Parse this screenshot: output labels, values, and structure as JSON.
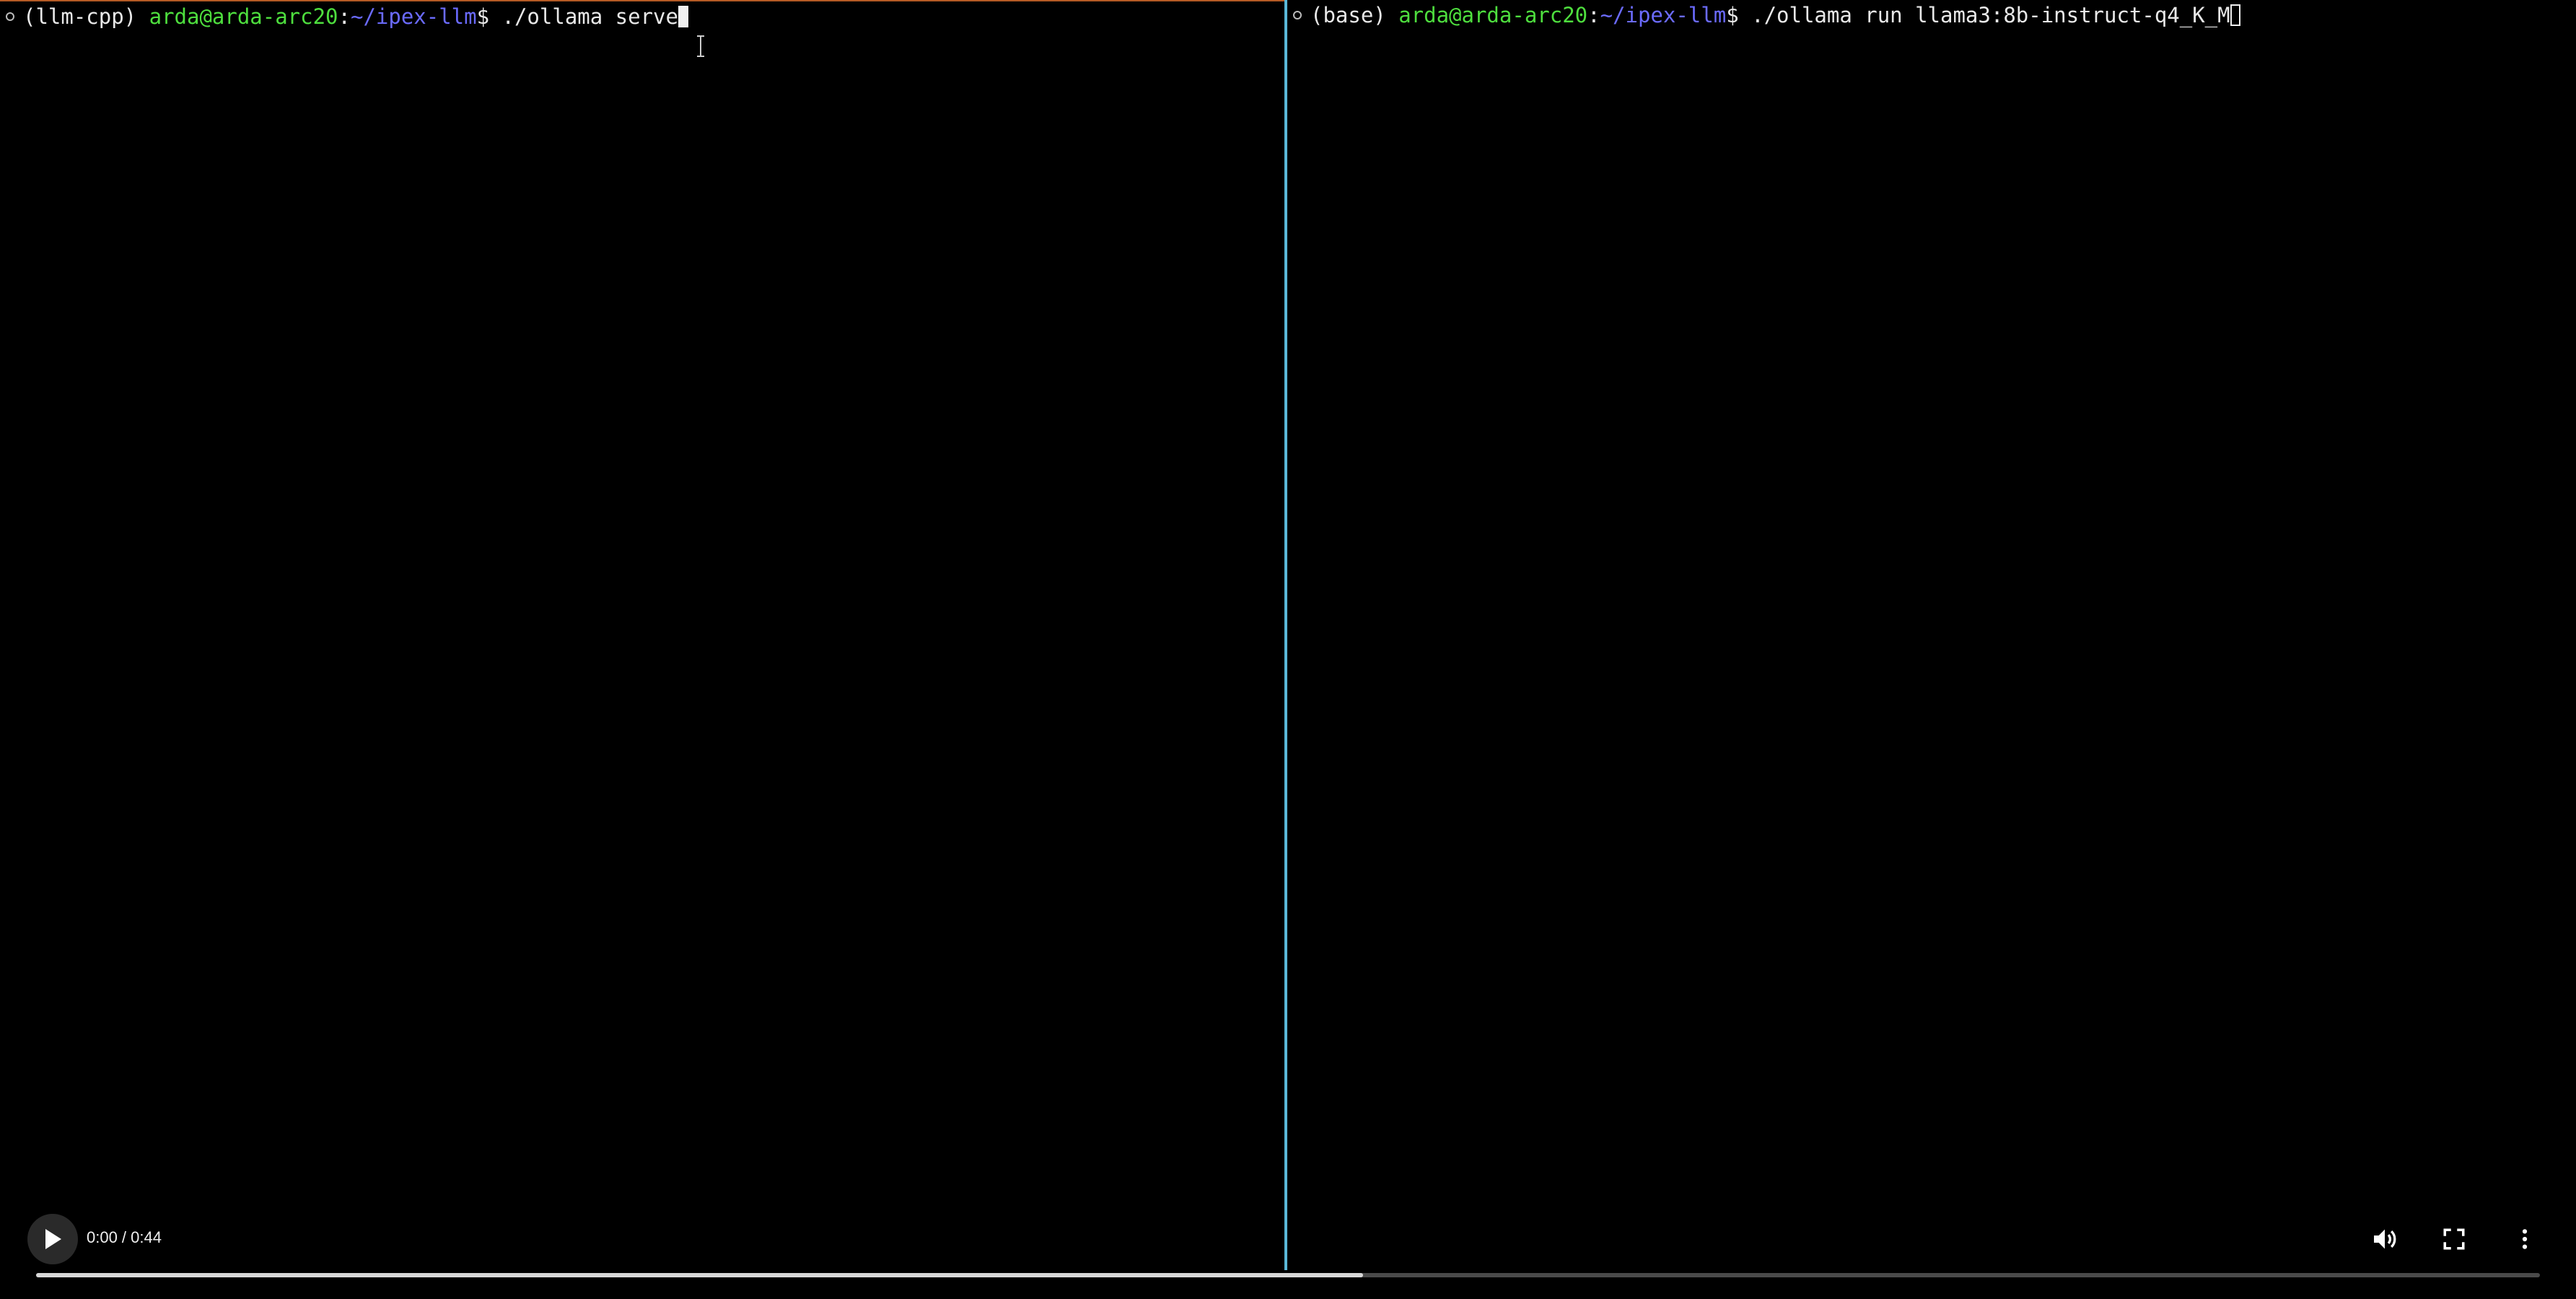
{
  "left_pane": {
    "env": "(llm-cpp) ",
    "user_host": "arda@arda-arc20",
    "sep": ":",
    "path": "~/ipex-llm",
    "dollar": "$ ",
    "command": "./ollama serve"
  },
  "right_pane": {
    "env": "(base) ",
    "user_host": "arda@arda-arc20",
    "sep": ":",
    "path": "~/ipex-llm",
    "dollar": "$ ",
    "command": "./ollama run llama3:8b-instruct-q4_K_M"
  },
  "player": {
    "time": "0:00 / 0:44",
    "buffered_fraction": 0.53,
    "icons": {
      "play": "play-icon",
      "volume": "volume-icon",
      "fullscreen": "fullscreen-icon",
      "more": "more-vertical-icon"
    }
  },
  "colors": {
    "user_host": "#4ede3e",
    "path": "#6b6bff",
    "left_pane_border": "#b45a24",
    "divider": "#5ab8d8"
  }
}
